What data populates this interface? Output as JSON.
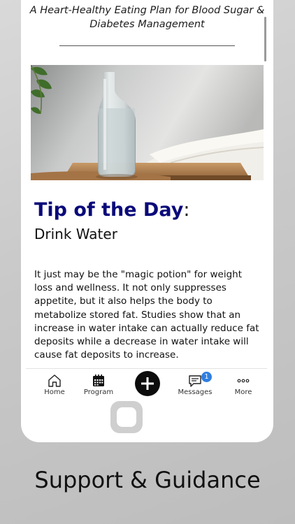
{
  "article": {
    "subtitle_line1": "A Heart-Healthy Eating Plan for Blood Sugar &",
    "subtitle_line2": "Diabetes Management",
    "tip_heading": "Tip of the Day",
    "tip_colon": ":",
    "tip_name": "Drink Water",
    "tip_body": "It just may be the \"magic potion\" for weight loss and wellness.  It not only suppresses appetite, but it also helps the body to metabolize stored fat.  Studies show that an increase in water intake can actually reduce fat deposits while a decrease in water intake will cause fat deposits to increase."
  },
  "tabs": {
    "home": "Home",
    "program": "Program",
    "messages": "Messages",
    "messages_badge": "1",
    "more": "More"
  },
  "caption": "Support & Guidance",
  "colors": {
    "title_blue": "#0a0a7a",
    "badge_blue": "#2f7fe0"
  },
  "icons": {
    "home": "home-icon",
    "program": "calendar-icon",
    "add": "plus-icon",
    "messages": "chat-icon",
    "more": "more-dots-icon"
  }
}
